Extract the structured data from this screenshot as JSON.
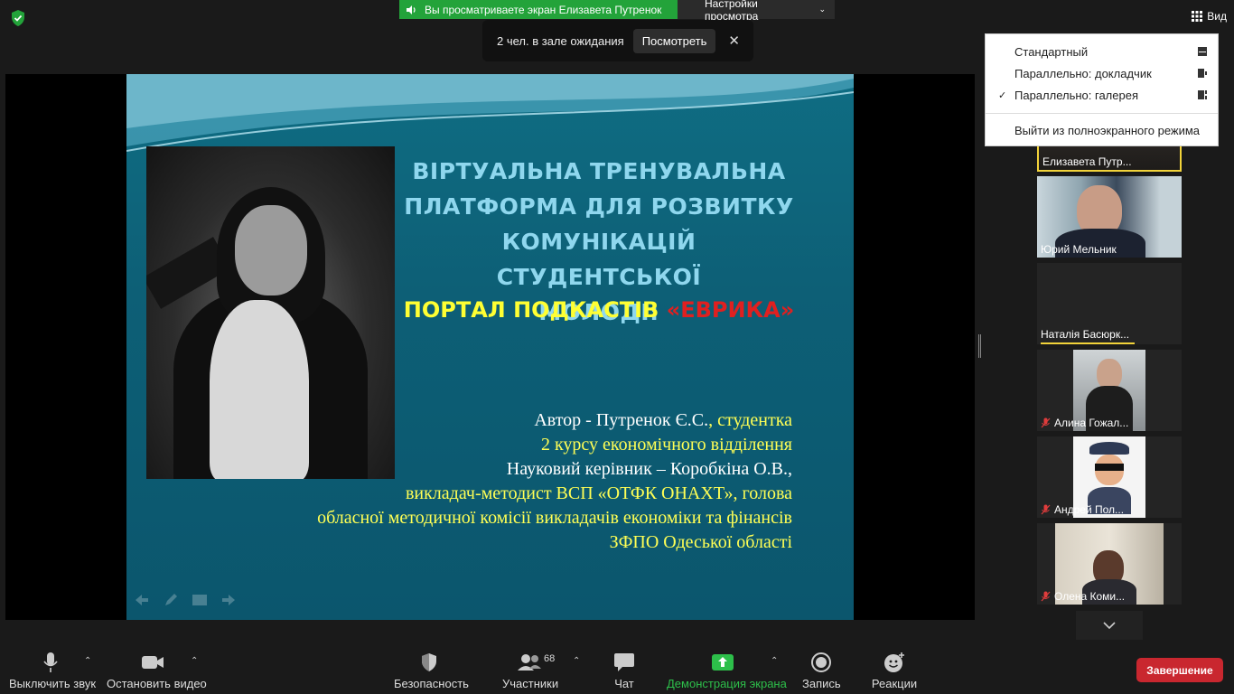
{
  "banner": {
    "sharing_text": "Вы просматриваете экран Елизавета Путренок",
    "view_settings": "Настройки просмотра"
  },
  "waiting_room": {
    "text": "2 чел. в зале ожидания",
    "view_button": "Посмотреть",
    "close": "✕"
  },
  "view_button": {
    "label": "Вид"
  },
  "view_menu": {
    "items": [
      {
        "label": "Стандартный",
        "checked": false
      },
      {
        "label": "Параллельно: докладчик",
        "checked": false
      },
      {
        "label": "Параллельно: галерея",
        "checked": true
      }
    ],
    "check_mark": "✓",
    "exit_fullscreen": "Выйти из полноэкранного режима"
  },
  "slide": {
    "title_lines": [
      "ВІРТУАЛЬНА ТРЕНУВАЛЬНА",
      "ПЛАТФОРМА ДЛЯ РОЗВИТКУ",
      "КОМУНІКАЦІЙ СТУДЕНТСЬКОЇ",
      "МОЛОДІ:"
    ],
    "subtitle_yellow": "ПОРТАЛ ПОДКАСТІВ ",
    "subtitle_red": "«ЕВРИКА»",
    "author_prefix": "Автор - Путренок Є.С.",
    "author_role": ", студентка",
    "course": "2 курсу економічного відділення",
    "supervisor": "Науковий керівник – Коробкіна О.В.,",
    "supervisor_role": "викладач-методист ВСП «ОТФК ОНАХТ», голова",
    "commission": "обласної методичної комісії викладачів економіки та фінансів",
    "region": "ЗФПО Одеської області"
  },
  "participants": [
    {
      "name": "Елизавета Путр...",
      "muted": false,
      "active": true
    },
    {
      "name": "Юрий Мельник",
      "muted": false,
      "active": false
    },
    {
      "name": "Наталія Басюрк...",
      "muted": false,
      "active": false,
      "speaking": true
    },
    {
      "name": "Алина Гожал...",
      "muted": true,
      "active": false
    },
    {
      "name": "Андрей Пол...",
      "muted": true,
      "active": false
    },
    {
      "name": "Олена Коми...",
      "muted": true,
      "active": false
    }
  ],
  "toolbar": {
    "mute": "Выключить звук",
    "stop_video": "Остановить видео",
    "security": "Безопасность",
    "participants": "Участники",
    "participants_count": "68",
    "chat": "Чат",
    "share_screen": "Демонстрация экрана",
    "record": "Запись",
    "reactions": "Реакции",
    "end": "Завершение"
  },
  "colors": {
    "share_green": "#23a33a",
    "end_red": "#c9272f",
    "speaker_yellow": "#f2d33a",
    "slide_teal": "#0d5f76",
    "title_cyan": "#8fd7ee"
  }
}
